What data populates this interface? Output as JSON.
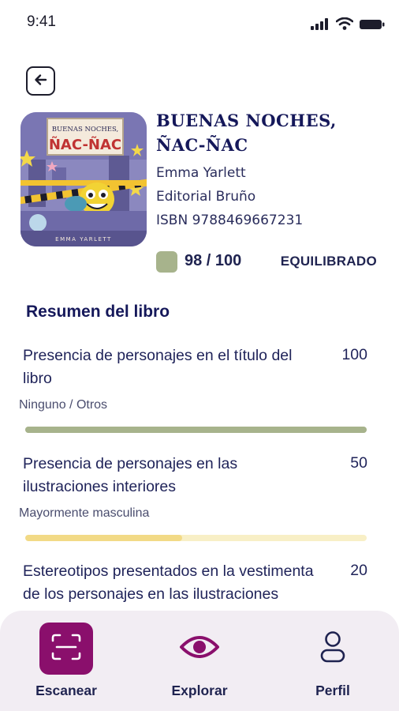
{
  "status": {
    "time": "9:41"
  },
  "book": {
    "title_line1": "BUENAS NOCHES,",
    "title_line2": "ÑAC-ÑAC",
    "author": "Emma Yarlett",
    "publisher": "Editorial Bruño",
    "isbn": "ISBN 9788469667231",
    "cover": {
      "title_line1": "BUENAS NOCHES,",
      "title_line2": "ÑAC-ÑAC",
      "author": "EMMA YARLETT"
    },
    "score": "98 / 100",
    "score_color": "#a7b38c",
    "rating_label": "EQUILIBRADO"
  },
  "summary": {
    "title": "Resumen del libro",
    "items": [
      {
        "text_line1": "Presencia de personajes en el título del",
        "text_line2": "libro",
        "value": "100",
        "subtitle": "Ninguno / Otros",
        "progress": 1.0,
        "bar_color": "#a7b38c",
        "track_color": "#a7b38c"
      },
      {
        "text_line1": "Presencia de personajes en las",
        "text_line2": "ilustraciones interiores",
        "value": "50",
        "subtitle": "Mayormente masculina",
        "progress": 0.46,
        "bar_color": "#f2da86",
        "track_color": "#f8efc6"
      },
      {
        "text_line1": "Estereotipos presentados en la vestimenta",
        "text_line2": "de los personajes en las ilustraciones",
        "value": "20"
      }
    ]
  },
  "nav": {
    "items": [
      {
        "label": "Escanear",
        "icon": "scan-icon",
        "active": true
      },
      {
        "label": "Explorar",
        "icon": "eye-icon"
      },
      {
        "label": "Perfil",
        "icon": "user-icon"
      }
    ],
    "active_color": "#8a0f6c"
  }
}
